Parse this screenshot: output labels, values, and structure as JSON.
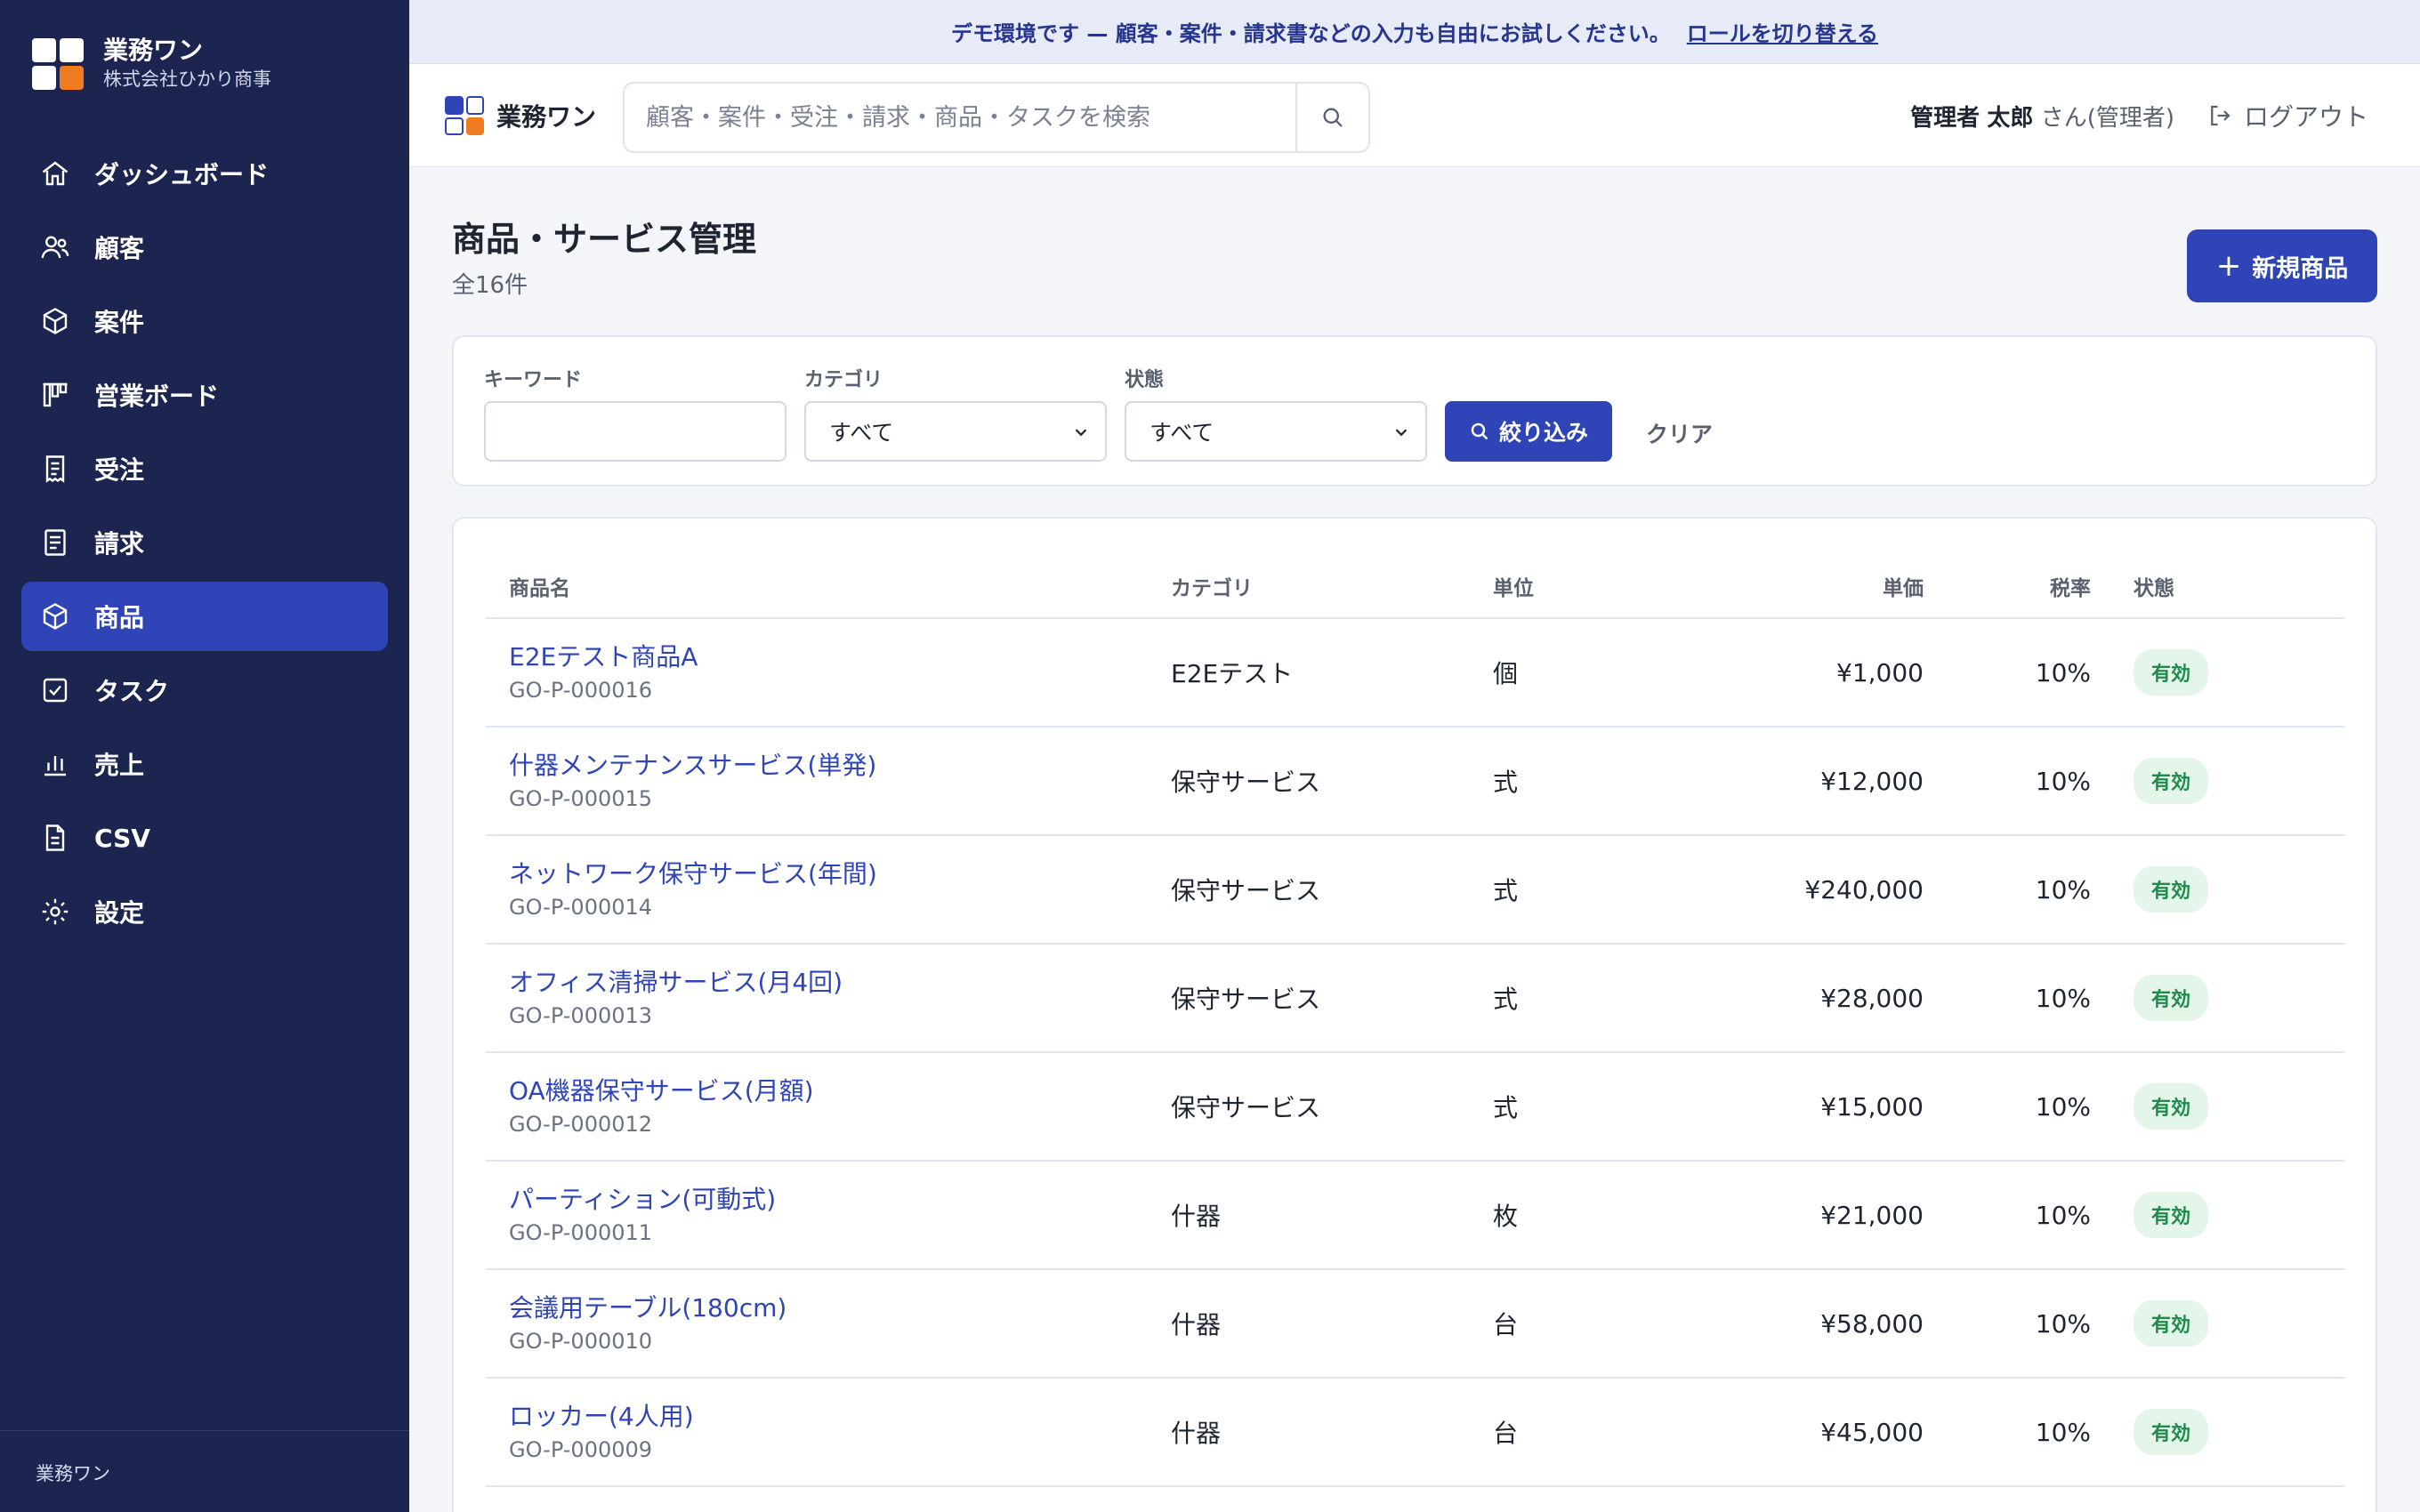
{
  "sidebar": {
    "brand_name": "業務ワン",
    "company": "株式会社ひかり商事",
    "items": [
      {
        "label": "ダッシュボード",
        "icon": "home-icon"
      },
      {
        "label": "顧客",
        "icon": "users-icon"
      },
      {
        "label": "案件",
        "icon": "box-icon"
      },
      {
        "label": "営業ボード",
        "icon": "kanban-icon"
      },
      {
        "label": "受注",
        "icon": "receipt-icon"
      },
      {
        "label": "請求",
        "icon": "document-icon"
      },
      {
        "label": "商品",
        "icon": "box-icon",
        "active": true
      },
      {
        "label": "タスク",
        "icon": "checkbox-icon"
      },
      {
        "label": "売上",
        "icon": "bar-chart-icon"
      },
      {
        "label": "CSV",
        "icon": "file-icon"
      },
      {
        "label": "設定",
        "icon": "gear-icon"
      }
    ],
    "footer": "業務ワン"
  },
  "banner": {
    "text": "デモ環境です — 顧客・案件・請求書などの入力も自由にお試しください。",
    "link": "ロールを切り替える"
  },
  "header": {
    "app_name": "業務ワン",
    "search_placeholder": "顧客・案件・受注・請求・商品・タスクを検索",
    "user_role": "管理者",
    "user_name": "太郎",
    "user_suffix": "さん(管理者)",
    "logout": "ログアウト"
  },
  "page": {
    "title": "商品・サービス管理",
    "count": "全16件",
    "new_button": "新規商品"
  },
  "filters": {
    "keyword_label": "キーワード",
    "keyword_value": "",
    "category_label": "カテゴリ",
    "category_value": "すべて",
    "status_label": "状態",
    "status_value": "すべて",
    "apply": "絞り込み",
    "clear": "クリア"
  },
  "table": {
    "columns": [
      "商品名",
      "カテゴリ",
      "単位",
      "単価",
      "税率",
      "状態"
    ],
    "rows": [
      {
        "name": "E2Eテスト商品A",
        "code": "GO-P-000016",
        "category": "E2Eテスト",
        "unit": "個",
        "price": "¥1,000",
        "tax": "10%",
        "status": "有効"
      },
      {
        "name": "什器メンテナンスサービス(単発)",
        "code": "GO-P-000015",
        "category": "保守サービス",
        "unit": "式",
        "price": "¥12,000",
        "tax": "10%",
        "status": "有効"
      },
      {
        "name": "ネットワーク保守サービス(年間)",
        "code": "GO-P-000014",
        "category": "保守サービス",
        "unit": "式",
        "price": "¥240,000",
        "tax": "10%",
        "status": "有効"
      },
      {
        "name": "オフィス清掃サービス(月4回)",
        "code": "GO-P-000013",
        "category": "保守サービス",
        "unit": "式",
        "price": "¥28,000",
        "tax": "10%",
        "status": "有効"
      },
      {
        "name": "OA機器保守サービス(月額)",
        "code": "GO-P-000012",
        "category": "保守サービス",
        "unit": "式",
        "price": "¥15,000",
        "tax": "10%",
        "status": "有効"
      },
      {
        "name": "パーティション(可動式)",
        "code": "GO-P-000011",
        "category": "什器",
        "unit": "枚",
        "price": "¥21,000",
        "tax": "10%",
        "status": "有効"
      },
      {
        "name": "会議用テーブル(180cm)",
        "code": "GO-P-000010",
        "category": "什器",
        "unit": "台",
        "price": "¥58,000",
        "tax": "10%",
        "status": "有効"
      },
      {
        "name": "ロッカー(4人用)",
        "code": "GO-P-000009",
        "category": "什器",
        "unit": "台",
        "price": "¥45,000",
        "tax": "10%",
        "status": "有効"
      }
    ]
  }
}
